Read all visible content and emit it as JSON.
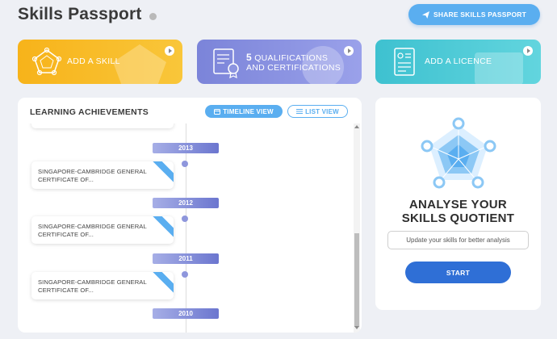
{
  "header": {
    "title": "Skills Passport",
    "share_label": "SHARE SKILLS PASSPORT"
  },
  "actions": {
    "skill": {
      "label": "ADD A SKILL"
    },
    "qualifications": {
      "count": "5",
      "line1": "QUALIFICATIONS",
      "line2": "AND CERTIFICATIONS"
    },
    "licence": {
      "label": "ADD A LICENCE"
    }
  },
  "learning": {
    "title": "LEARNING ACHIEVEMENTS",
    "timeline_label": "TIMELINE VIEW",
    "list_label": "LIST VIEW",
    "years": [
      "2013",
      "2012",
      "2011",
      "2010"
    ],
    "achievements": [
      {
        "line1": "SINGAPORE-CAMBRIDGE GENERAL",
        "line2": "CERTIFICATE OF..."
      },
      {
        "line1": "SINGAPORE-CAMBRIDGE GENERAL",
        "line2": "CERTIFICATE OF..."
      },
      {
        "line1": "SINGAPORE-CAMBRIDGE GENERAL",
        "line2": "CERTIFICATE OF..."
      }
    ]
  },
  "analyse": {
    "title_line1": "ANALYSE YOUR",
    "title_line2": "SKILLS QUOTIENT",
    "input_placeholder": "Update your skills for better analysis",
    "start_label": "START"
  },
  "colors": {
    "accent_blue": "#5aaef0",
    "start_blue": "#2f6fd6",
    "skill_yellow": "#f7b31a",
    "qual_purple": "#7b84d9",
    "licence_teal": "#3ec1d0"
  },
  "icons": {
    "share": "paper-plane-icon",
    "timeline": "calendar-icon",
    "list": "list-icon",
    "play": "play-icon",
    "skill": "radar-chart-icon",
    "qualification": "certificate-icon",
    "licence": "id-card-icon"
  }
}
